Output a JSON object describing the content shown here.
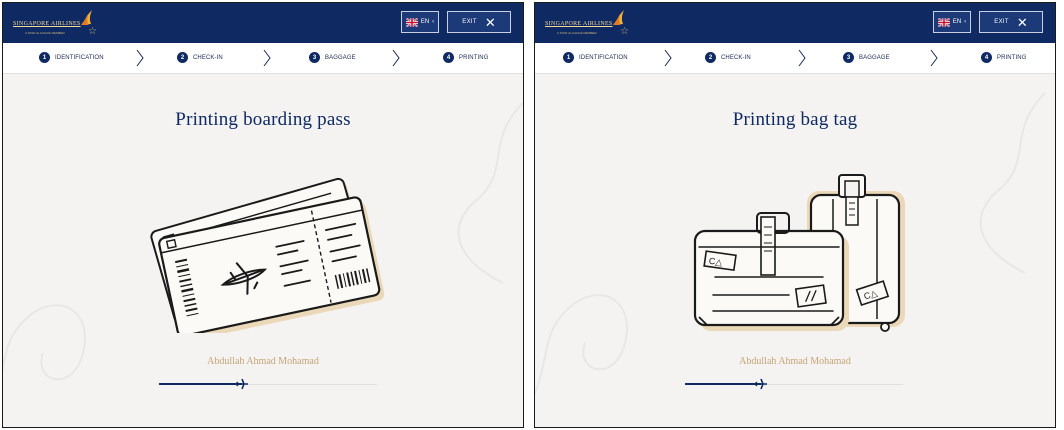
{
  "brand": {
    "name": "SINGAPORE AIRLINES",
    "tagline": "A STAR ALLIANCE MEMBER"
  },
  "header": {
    "language_label": "EN",
    "exit_label": "EXIT"
  },
  "steps": [
    {
      "number": "1",
      "label": "IDENTIFICATION"
    },
    {
      "number": "2",
      "label": "CHECK-IN"
    },
    {
      "number": "3",
      "label": "BAGGAGE"
    },
    {
      "number": "4",
      "label": "PRINTING"
    }
  ],
  "screens": [
    {
      "title": "Printing boarding pass",
      "passenger": "Abdullah Ahmad Mohamad",
      "progress": 0.38,
      "illustration": "boarding-pass-illustration"
    },
    {
      "title": "Printing bag tag",
      "passenger": "Abdullah Ahmad Mohamad",
      "progress": 0.35,
      "illustration": "luggage-illustration"
    }
  ],
  "colors": {
    "navy": "#0f2a63",
    "gold": "#c5a577",
    "background": "#f4f3f1"
  }
}
